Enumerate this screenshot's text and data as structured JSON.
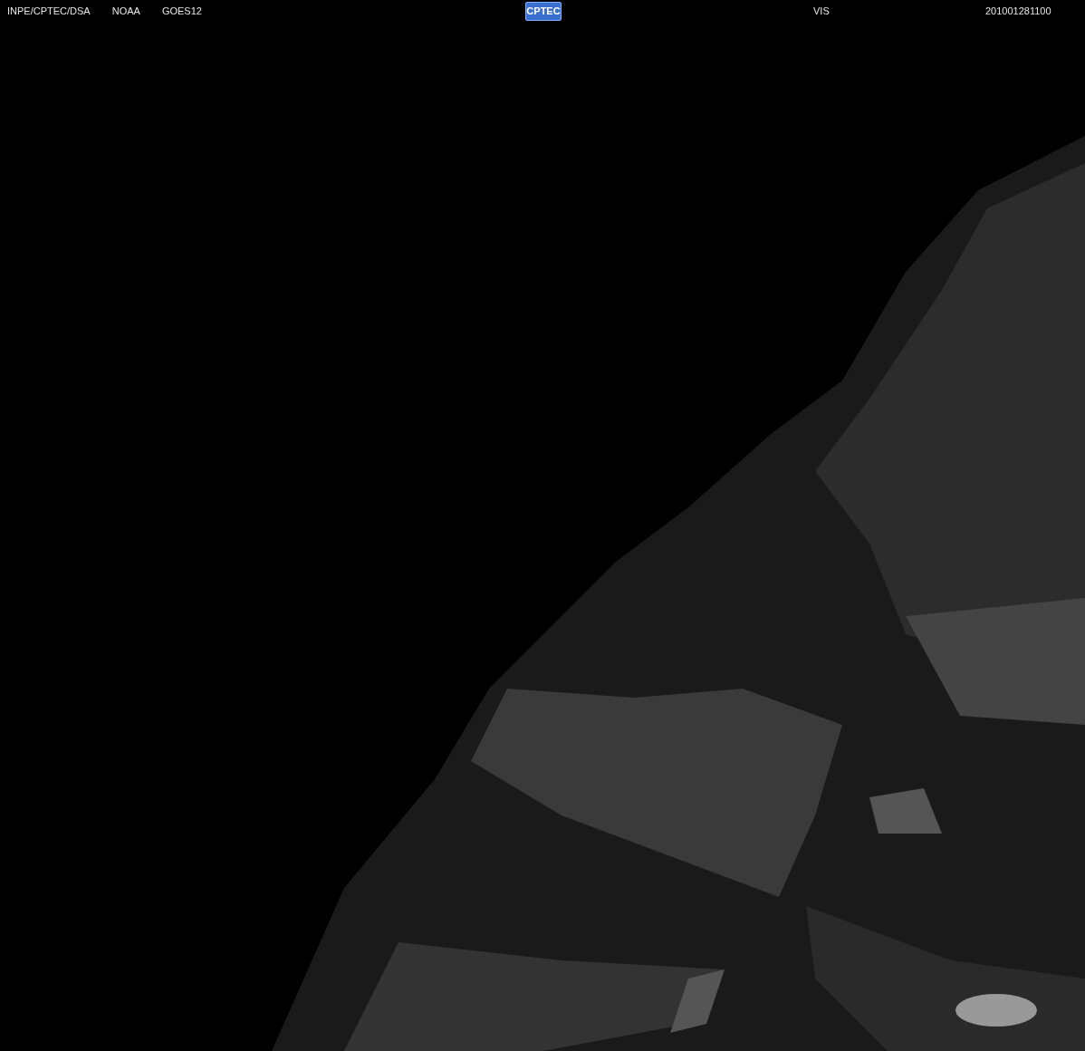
{
  "header": {
    "credits": [
      "INPE/CPTEC/DSA",
      "NOAA",
      "GOES12"
    ],
    "logo": "CPTEC",
    "channel": "VIS",
    "timestamp": "201001281100"
  }
}
